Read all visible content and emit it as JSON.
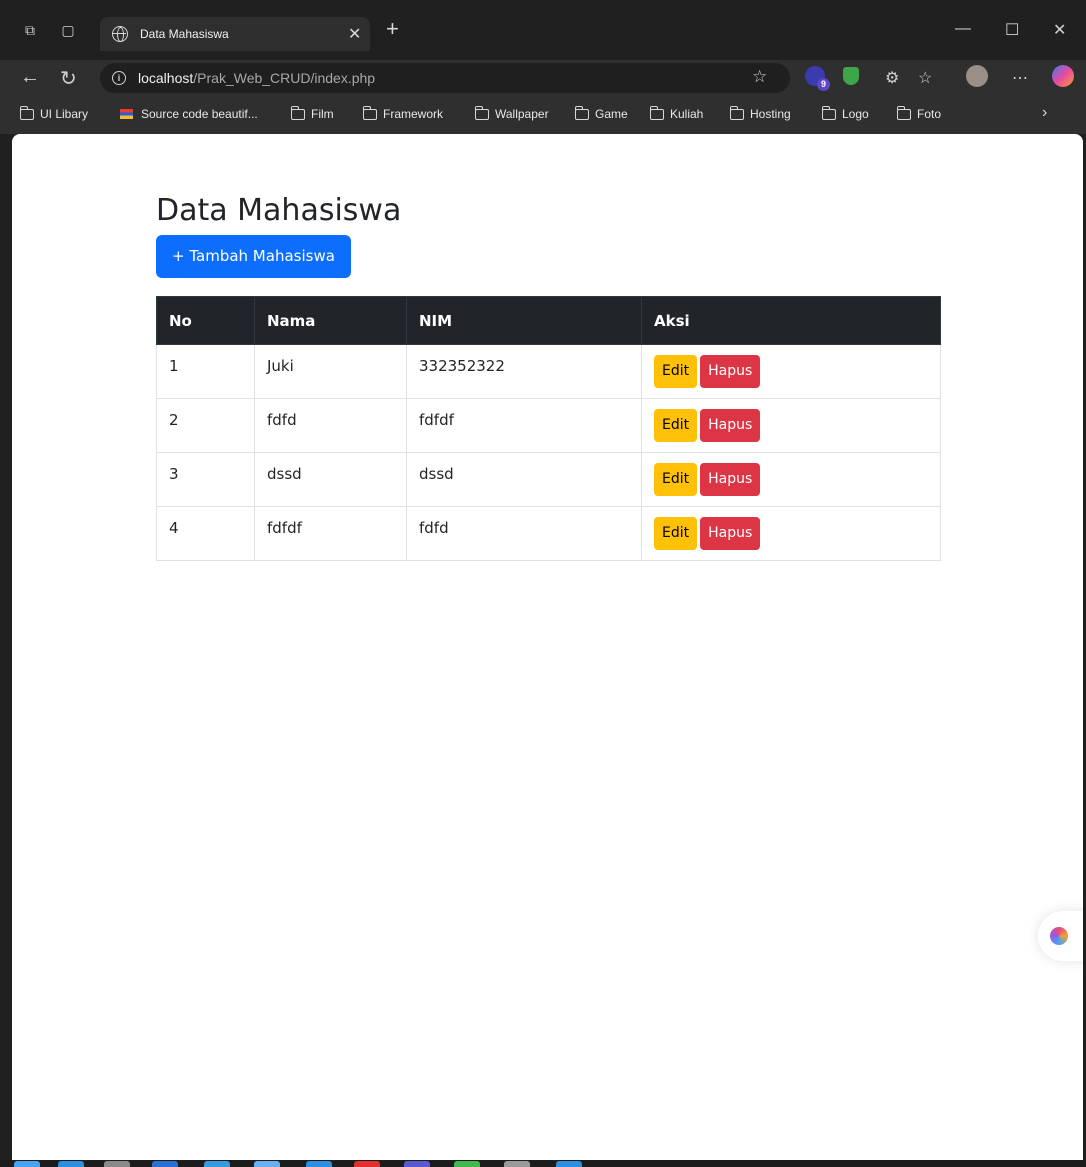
{
  "browser": {
    "tab_title": "Data Mahasiswa",
    "url_host": "localhost",
    "url_path": "/Prak_Web_CRUD/index.php",
    "extension_badge": "9",
    "bookmarks": [
      "UI Libary",
      "Source code beautif...",
      "Film",
      "Framework",
      "Wallpaper",
      "Game",
      "Kuliah",
      "Hosting",
      "Logo",
      "Foto"
    ]
  },
  "page": {
    "title": "Data Mahasiswa",
    "add_button": "+ Tambah Mahasiswa",
    "table": {
      "headers": [
        "No",
        "Nama",
        "NIM",
        "Aksi"
      ],
      "rows": [
        {
          "no": "1",
          "nama": "Juki",
          "nim": "332352322"
        },
        {
          "no": "2",
          "nama": "fdfd",
          "nim": "fdfdf"
        },
        {
          "no": "3",
          "nama": "dssd",
          "nim": "dssd"
        },
        {
          "no": "4",
          "nama": "fdfdf",
          "nim": "fdfd"
        }
      ],
      "edit_label": "Edit",
      "delete_label": "Hapus"
    }
  },
  "colors": {
    "primary": "#0d6efd",
    "warning": "#ffc107",
    "danger": "#dc3545",
    "table_head": "#212529"
  }
}
